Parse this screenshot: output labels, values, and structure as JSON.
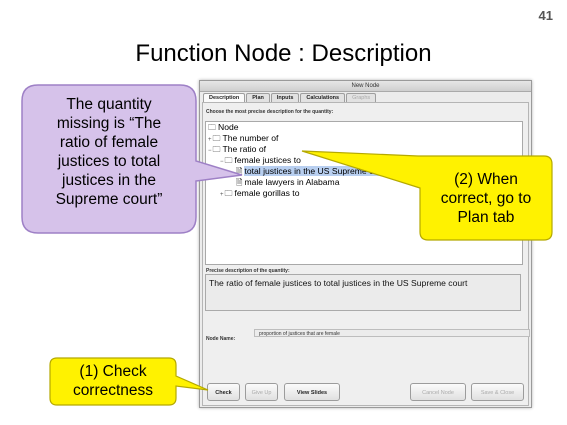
{
  "slide": {
    "number": "41",
    "title": "Function Node : Description"
  },
  "window": {
    "title": "New Node"
  },
  "tabs": [
    {
      "label": "Description",
      "state": "active"
    },
    {
      "label": "Plan",
      "state": "normal"
    },
    {
      "label": "Inputs",
      "state": "normal"
    },
    {
      "label": "Calculations",
      "state": "normal"
    },
    {
      "label": "Graphs",
      "state": "disabled"
    }
  ],
  "tree": {
    "heading": "Choose the most precise description for the quantity:",
    "root": "Node",
    "items": [
      {
        "label": "The number of",
        "glyph": "+"
      },
      {
        "label": "The ratio of",
        "glyph": "−"
      },
      {
        "label": "female justices to",
        "glyph": "−"
      },
      {
        "label": "total justices in the US Supreme court",
        "glyph": ""
      },
      {
        "label": "male lawyers in Alabama",
        "glyph": ""
      },
      {
        "label": "female gorillas to",
        "glyph": "+"
      }
    ]
  },
  "precise_description": {
    "label": "Precise description of the quantity:",
    "value": "The ratio of female justices to total justices in the US Supreme court"
  },
  "node_name": {
    "label": "Node Name:",
    "value": "proportion of justices that are female"
  },
  "buttons": {
    "check": "Check",
    "give_up": "Give Up",
    "view_slides": "View Slides",
    "cancel_node": "Cancel Node",
    "save_close": "Save & Close"
  },
  "callouts": {
    "left": [
      "The quantity",
      "missing is “The",
      "ratio of female",
      "justices to total",
      "justices in the",
      "Supreme court”"
    ],
    "right": [
      "(2) When",
      "correct, go to",
      "Plan tab"
    ],
    "bottom": [
      "(1) Check",
      "correctness"
    ]
  },
  "colors": {
    "left_callout_fill": "#d6c2ea",
    "left_callout_stroke": "#9e80c6",
    "yellow_callout_fill": "#fff200",
    "yellow_callout_stroke": "#b5a900",
    "selection": "#b8cff0"
  }
}
